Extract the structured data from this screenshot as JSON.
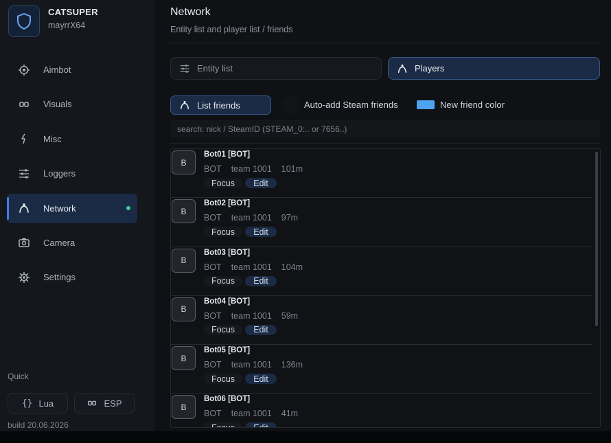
{
  "brand": {
    "name": "CATSUPER",
    "user": "mayrrX64",
    "logo_icon": "shield-icon"
  },
  "nav": [
    {
      "label": "Aimbot",
      "icon": "crosshair-icon",
      "active": false
    },
    {
      "label": "Visuals",
      "icon": "glasses-icon",
      "active": false
    },
    {
      "label": "Misc",
      "icon": "bolt-icon",
      "active": false
    },
    {
      "label": "Loggers",
      "icon": "sliders-icon",
      "active": false
    },
    {
      "label": "Network",
      "icon": "user-icon",
      "active": true
    },
    {
      "label": "Camera",
      "icon": "camera-icon",
      "active": false
    },
    {
      "label": "Settings",
      "icon": "gear-icon",
      "active": false
    }
  ],
  "quick": {
    "label": "Quick",
    "lua_label": "Lua",
    "esp_label": "ESP"
  },
  "build": "build 20.06.2026",
  "page": {
    "title": "Network",
    "subtitle": "Entity list and player list / friends"
  },
  "tabs": {
    "entity_label": "Entity list",
    "players_label": "Players"
  },
  "controls": {
    "list_friends_label": "List friends",
    "auto_add_label": "Auto-add Steam friends",
    "new_friend_color_label": "New friend color",
    "new_friend_color": "#4da3f0",
    "search_placeholder": "search: nick / SteamID (STEAM_0:.. or 7656..)"
  },
  "actions": {
    "focus": "Focus",
    "edit": "Edit"
  },
  "players": [
    {
      "initial": "B",
      "name": "Bot01  [BOT]",
      "type": "BOT",
      "team": "team 1001",
      "distance": "101m"
    },
    {
      "initial": "B",
      "name": "Bot02  [BOT]",
      "type": "BOT",
      "team": "team 1001",
      "distance": "97m"
    },
    {
      "initial": "B",
      "name": "Bot03  [BOT]",
      "type": "BOT",
      "team": "team 1001",
      "distance": "104m"
    },
    {
      "initial": "B",
      "name": "Bot04  [BOT]",
      "type": "BOT",
      "team": "team 1001",
      "distance": "59m"
    },
    {
      "initial": "B",
      "name": "Bot05  [BOT]",
      "type": "BOT",
      "team": "team 1001",
      "distance": "136m"
    },
    {
      "initial": "B",
      "name": "Bot06  [BOT]",
      "type": "BOT",
      "team": "team 1001",
      "distance": "41m"
    }
  ],
  "colors": {
    "accent": "#3d7fe0",
    "active_bg": "#1b2b45",
    "online_dot": "#3ecf8e"
  }
}
